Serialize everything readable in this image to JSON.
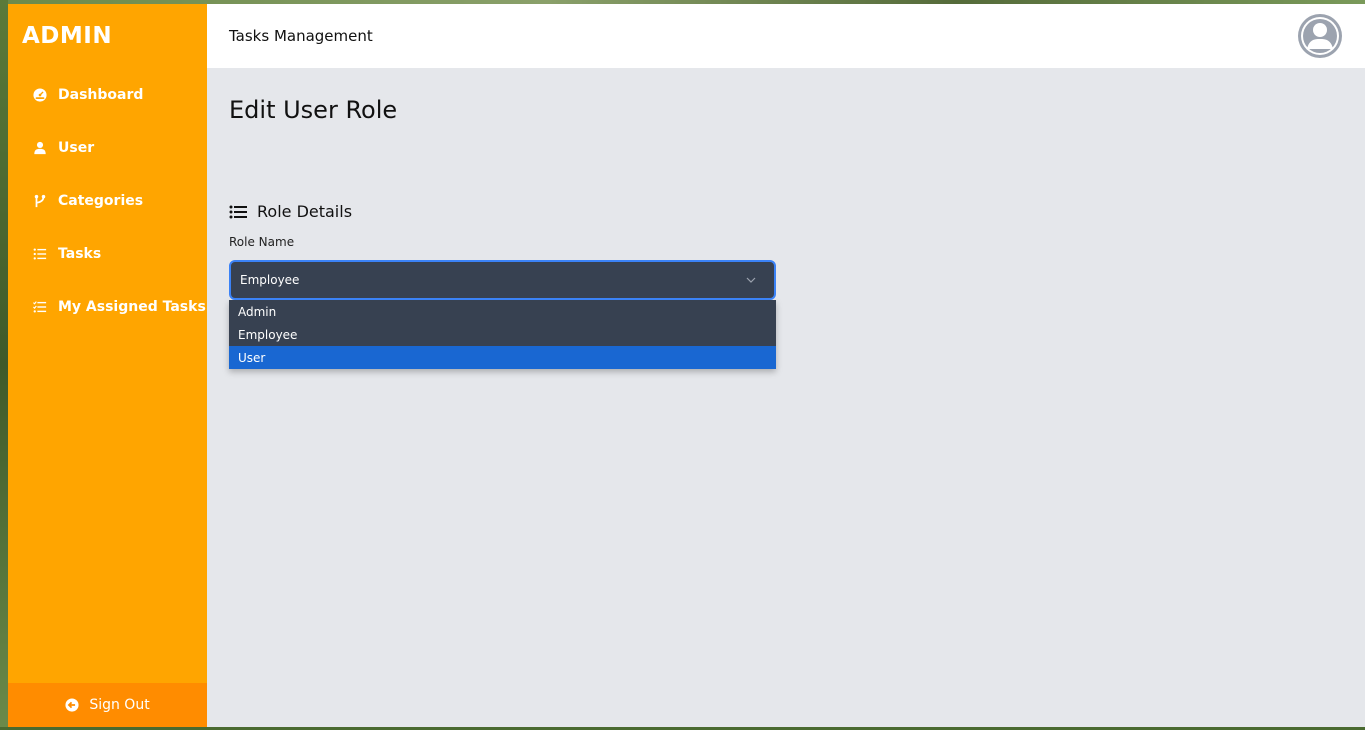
{
  "brand": "ADMIN",
  "header": {
    "title": "Tasks Management"
  },
  "sidebar": {
    "items": [
      {
        "label": "Dashboard",
        "icon": "dashboard-gauge-icon"
      },
      {
        "label": "User",
        "icon": "user-icon"
      },
      {
        "label": "Categories",
        "icon": "branch-icon"
      },
      {
        "label": "Tasks",
        "icon": "list-icon"
      },
      {
        "label": "My Assigned Tasks",
        "icon": "checklist-icon"
      }
    ],
    "signout": {
      "label": "Sign Out",
      "icon": "arrow-left-circle-icon"
    }
  },
  "main": {
    "page_title": "Edit User Role",
    "section_title": "Role Details",
    "field_label": "Role Name",
    "select_value": "Employee",
    "options": [
      "Admin",
      "Employee",
      "User"
    ],
    "highlighted_option": "User"
  },
  "colors": {
    "sidebar": "#ffa500",
    "signout": "#ff8c00",
    "select_bg": "#374151",
    "focus_border": "#3b82f6",
    "highlight": "#1967d2",
    "content_bg": "#e5e7eb"
  }
}
